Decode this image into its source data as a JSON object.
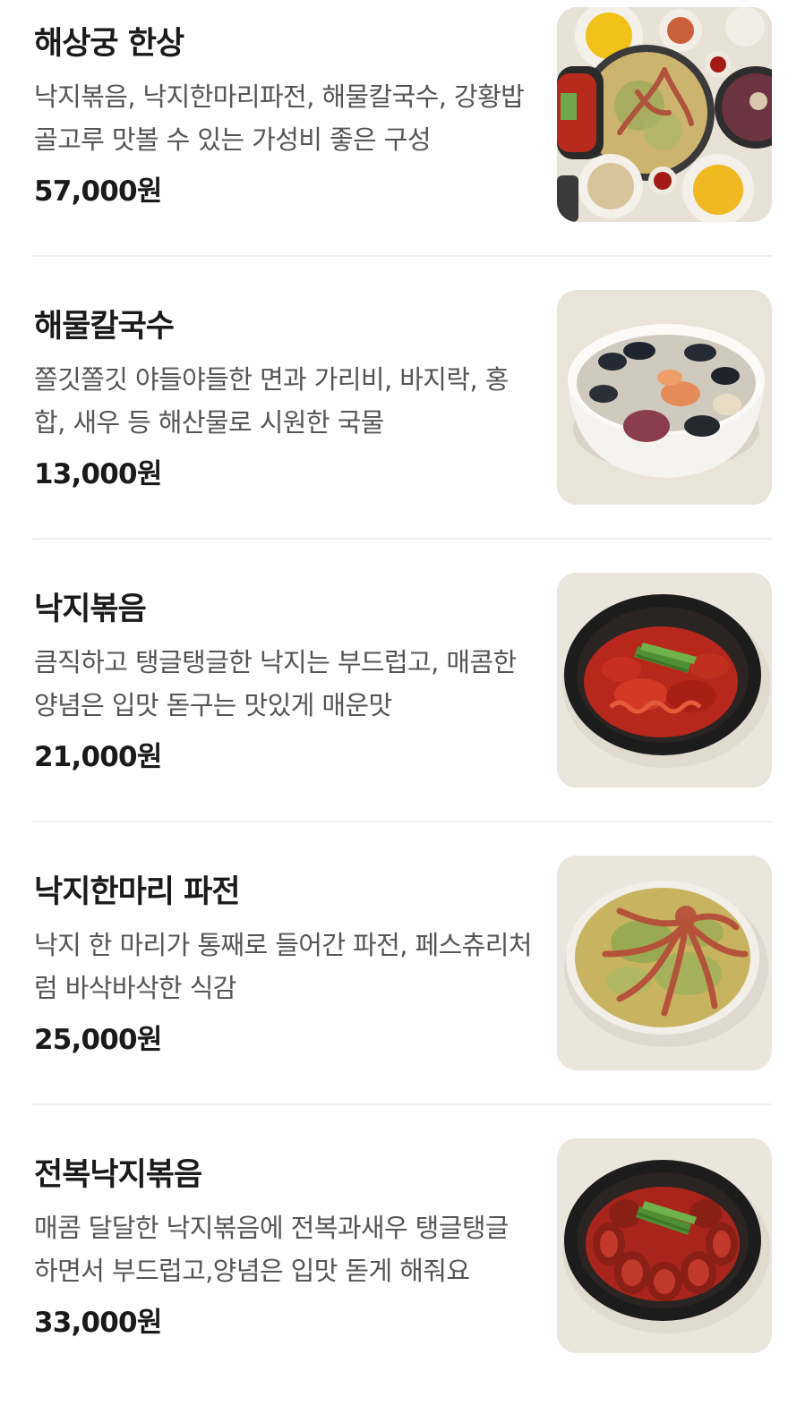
{
  "menu": {
    "items": [
      {
        "name": "해상궁 한상",
        "description": "낙지볶음, 낙지한마리파전, 해물칼국수, 강황밥 골고루 맛볼 수 있는 가성비 좋은 구성",
        "price": "57,000원",
        "image": "seafood-set-table"
      },
      {
        "name": "해물칼국수",
        "description": "쫄깃쫄깃 야들야들한 면과 가리비, 바지락, 홍합, 새우 등 해산물로 시원한 국물",
        "price": "13,000원",
        "image": "seafood-noodle-soup"
      },
      {
        "name": "낙지볶음",
        "description": "큼직하고 탱글탱글한 낙지는 부드럽고, 매콤한 양념은 입맛 돋구는 맛있게 매운맛",
        "price": "21,000원",
        "image": "spicy-stir-fried-octopus"
      },
      {
        "name": "낙지한마리 파전",
        "description": "낙지 한 마리가 통째로 들어간 파전, 페스츄리처럼 바삭바삭한 식감",
        "price": "25,000원",
        "image": "whole-octopus-pancake"
      },
      {
        "name": "전복낙지볶음",
        "description": "매콤 달달한 낙지볶음에 전복과새우 탱글탱글 하면서 부드럽고,양념은 입맛 돋게 해줘요",
        "price": "33,000원",
        "image": "abalone-octopus-stir-fry"
      }
    ]
  }
}
